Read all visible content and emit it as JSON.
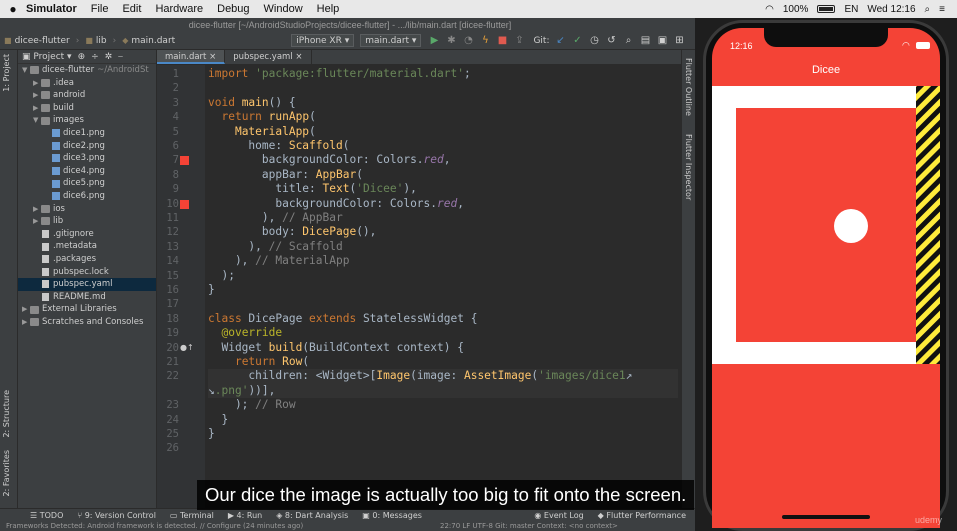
{
  "menubar": {
    "app_name": "Simulator",
    "items": [
      "File",
      "Edit",
      "Hardware",
      "Debug",
      "Window",
      "Help"
    ],
    "battery": "100%",
    "language": "EN",
    "clock": "Wed 12:16"
  },
  "window": {
    "title": "dicee-flutter [~/AndroidStudioProjects/dicee-flutter] - .../lib/main.dart [dicee-flutter]"
  },
  "navbar": {
    "crumbs": [
      "dicee-flutter",
      "lib",
      "main.dart"
    ],
    "device": "iPhone XR",
    "run_config": "main.dart",
    "git_label": "Git:"
  },
  "project_panel": {
    "title": "Project",
    "tree": [
      {
        "label": "dicee-flutter",
        "sub": "~/AndroidSt",
        "kind": "folder",
        "indent": 0,
        "arrow": "▼"
      },
      {
        "label": ".idea",
        "kind": "folder",
        "indent": 1,
        "arrow": "▶"
      },
      {
        "label": "android",
        "kind": "folder",
        "indent": 1,
        "arrow": "▶"
      },
      {
        "label": "build",
        "kind": "folder",
        "indent": 1,
        "arrow": "▶"
      },
      {
        "label": "images",
        "kind": "folder",
        "indent": 1,
        "arrow": "▼"
      },
      {
        "label": "dice1.png",
        "kind": "img",
        "indent": 2,
        "arrow": ""
      },
      {
        "label": "dice2.png",
        "kind": "img",
        "indent": 2,
        "arrow": ""
      },
      {
        "label": "dice3.png",
        "kind": "img",
        "indent": 2,
        "arrow": ""
      },
      {
        "label": "dice4.png",
        "kind": "img",
        "indent": 2,
        "arrow": ""
      },
      {
        "label": "dice5.png",
        "kind": "img",
        "indent": 2,
        "arrow": ""
      },
      {
        "label": "dice6.png",
        "kind": "img",
        "indent": 2,
        "arrow": ""
      },
      {
        "label": "ios",
        "kind": "folder",
        "indent": 1,
        "arrow": "▶"
      },
      {
        "label": "lib",
        "kind": "folder",
        "indent": 1,
        "arrow": "▶"
      },
      {
        "label": ".gitignore",
        "kind": "file",
        "indent": 1,
        "arrow": ""
      },
      {
        "label": ".metadata",
        "kind": "file",
        "indent": 1,
        "arrow": ""
      },
      {
        "label": ".packages",
        "kind": "file",
        "indent": 1,
        "arrow": ""
      },
      {
        "label": "pubspec.lock",
        "kind": "file",
        "indent": 1,
        "arrow": ""
      },
      {
        "label": "pubspec.yaml",
        "kind": "file",
        "indent": 1,
        "arrow": "",
        "selected": true
      },
      {
        "label": "README.md",
        "kind": "file",
        "indent": 1,
        "arrow": ""
      },
      {
        "label": "External Libraries",
        "kind": "folder",
        "indent": 0,
        "arrow": "▶"
      },
      {
        "label": "Scratches and Consoles",
        "kind": "folder",
        "indent": 0,
        "arrow": "▶"
      }
    ]
  },
  "tabs": [
    {
      "label": "main.dart",
      "active": true
    },
    {
      "label": "pubspec.yaml",
      "active": false
    }
  ],
  "editor": {
    "lines": [
      {
        "n": "1",
        "html": "<span class=\"kw\">import </span><span class=\"str\">'package:flutter/material.dart'</span>;"
      },
      {
        "n": "2",
        "html": ""
      },
      {
        "n": "3",
        "html": "<span class=\"kw\">void </span><span class=\"cls\">main</span>() {"
      },
      {
        "n": "4",
        "html": "  <span class=\"kw\">return </span><span class=\"cls\">runApp</span>("
      },
      {
        "n": "5",
        "html": "    <span class=\"cls\">MaterialApp</span>("
      },
      {
        "n": "6",
        "html": "      home: <span class=\"cls\">Scaffold</span>("
      },
      {
        "n": "7",
        "html": "        backgroundColor: Colors.<span class=\"fld\">red</span>,",
        "marker": true
      },
      {
        "n": "8",
        "html": "        appBar: <span class=\"cls\">AppBar</span>("
      },
      {
        "n": "9",
        "html": "          title: <span class=\"cls\">Text</span>(<span class=\"str\">'Dicee'</span>),"
      },
      {
        "n": "10",
        "html": "          backgroundColor: Colors.<span class=\"fld\">red</span>,",
        "marker": true
      },
      {
        "n": "11",
        "html": "        ), <span class=\"cmt\">// AppBar</span>"
      },
      {
        "n": "12",
        "html": "        body: <span class=\"cls\">DicePage</span>(),"
      },
      {
        "n": "13",
        "html": "      ), <span class=\"cmt\">// Scaffold</span>"
      },
      {
        "n": "14",
        "html": "    ), <span class=\"cmt\">// MaterialApp</span>"
      },
      {
        "n": "15",
        "html": "  );"
      },
      {
        "n": "16",
        "html": "}"
      },
      {
        "n": "17",
        "html": ""
      },
      {
        "n": "18",
        "html": "<span class=\"kw\">class </span>DicePage <span class=\"kw\">extends </span>StatelessWidget {"
      },
      {
        "n": "19",
        "html": "  <span class=\"ann\">@override</span>"
      },
      {
        "n": "20",
        "html": "  Widget <span class=\"cls\">build</span>(BuildContext context) {",
        "bulb": true
      },
      {
        "n": "21",
        "html": "    <span class=\"kw\">return </span><span class=\"cls\">Row</span>("
      },
      {
        "n": "22",
        "html": "      children: &lt;Widget&gt;[<span class=\"cls\">Image</span>(image: <span class=\"cls\">AssetImage</span>(<span class=\"str\">'images/dice1</span>↗",
        "current": true
      },
      {
        "n": "",
        "html": "↘<span class=\"str\">.png'</span>))],",
        "current": true
      },
      {
        "n": "23",
        "html": "    ); <span class=\"cmt\">// Row</span>"
      },
      {
        "n": "24",
        "html": "  }"
      },
      {
        "n": "25",
        "html": "}"
      },
      {
        "n": "26",
        "html": ""
      }
    ]
  },
  "left_tools": [
    "1: Project",
    "2: Structure",
    "2: Favorites"
  ],
  "right_tools": [
    "Flutter Outline",
    "Flutter Inspector"
  ],
  "bottom_tools": [
    "TODO",
    "9: Version Control",
    "Terminal",
    "4: Run",
    "8: Dart Analysis",
    "0: Messages",
    "Event Log",
    "Flutter Performance"
  ],
  "statusbar": {
    "text": "Frameworks Detected: Android framework is detected. // Configure (24 minutes ago)",
    "right": "22:70  LF  UTF-8  Git: master  Context: <no context>"
  },
  "simulator": {
    "time": "12:16",
    "app_title": "Dicee"
  },
  "caption": "Our dice the image is actually too big to fit onto the screen.",
  "watermark": "udemy",
  "colors": {
    "red": "#f44336",
    "selection": "#0d293e"
  }
}
